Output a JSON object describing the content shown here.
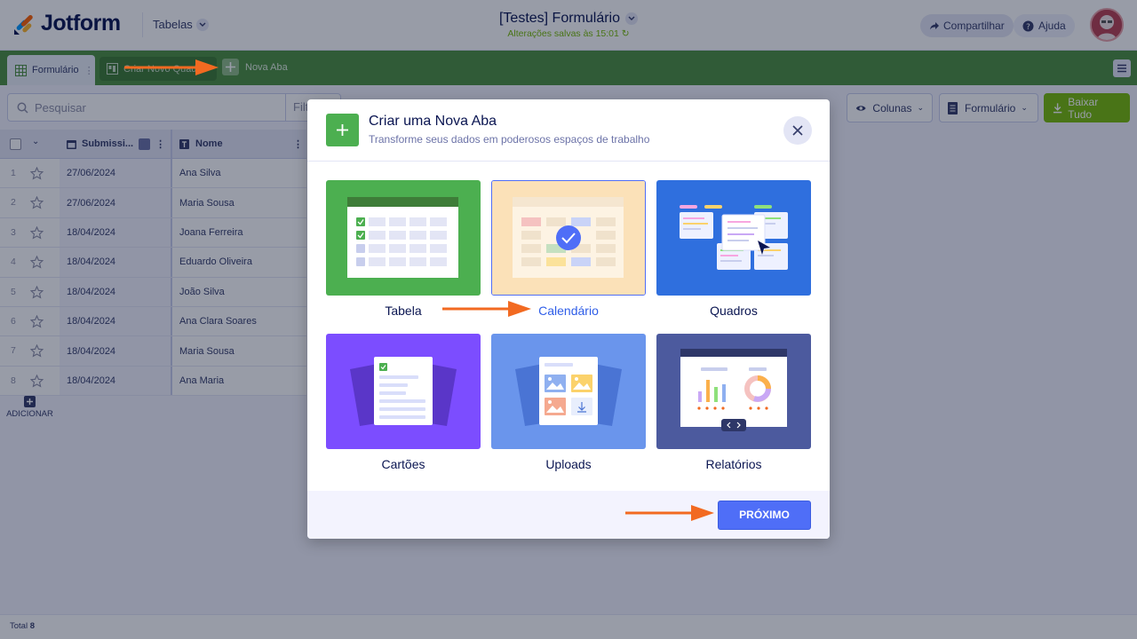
{
  "header": {
    "brand": "Jotform",
    "tables_menu_label": "Tabelas",
    "doc_title": "[Testes] Formulário",
    "save_status": "Alterações salvas às 15:01",
    "share_label": "Compartilhar",
    "help_label": "Ajuda"
  },
  "tabs": {
    "active_label": "Formulário",
    "second_label": "Criar Novo Quadro",
    "new_tab_label": "Nova Aba"
  },
  "toolbar": {
    "search_placeholder": "Pesquisar",
    "filter_label": "Filt",
    "columns_label": "Colunas",
    "form_label": "Formulário",
    "download_label": "Baixar Tudo"
  },
  "table": {
    "columns": [
      "Submissi...",
      "Nome"
    ],
    "rows": [
      {
        "num": "1",
        "date": "27/06/2024",
        "name": "Ana Silva"
      },
      {
        "num": "2",
        "date": "27/06/2024",
        "name": "Maria Sousa"
      },
      {
        "num": "3",
        "date": "18/04/2024",
        "name": "Joana Ferreira"
      },
      {
        "num": "4",
        "date": "18/04/2024",
        "name": "Eduardo Oliveira"
      },
      {
        "num": "5",
        "date": "18/04/2024",
        "name": "João Silva"
      },
      {
        "num": "6",
        "date": "18/04/2024",
        "name": "Ana Clara Soares"
      },
      {
        "num": "7",
        "date": "18/04/2024",
        "name": "Maria Sousa"
      },
      {
        "num": "8",
        "date": "18/04/2024",
        "name": "Ana Maria"
      }
    ],
    "add_label": "ADICIONAR",
    "total_label": "Total",
    "total_count": "8"
  },
  "modal": {
    "title": "Criar uma Nova Aba",
    "subtitle": "Transforme seus dados em poderosos espaços de trabalho",
    "options": [
      {
        "label": "Tabela",
        "color": "#4caf50",
        "selected": false
      },
      {
        "label": "Calendário",
        "color": "#fbe1b8",
        "selected": true
      },
      {
        "label": "Quadros",
        "color": "#2f6fde",
        "selected": false
      },
      {
        "label": "Cartões",
        "color": "#7c4dff",
        "selected": false
      },
      {
        "label": "Uploads",
        "color": "#6a95ec",
        "selected": false
      },
      {
        "label": "Relatórios",
        "color": "#4c5a9e",
        "selected": false
      }
    ],
    "next_label": "PRÓXIMO"
  },
  "colors": {
    "accent": "#4f6ef7",
    "tab_bar": "#4c8f3f",
    "annotation_arrow": "#f26a21",
    "download_green": "#78bb07"
  }
}
